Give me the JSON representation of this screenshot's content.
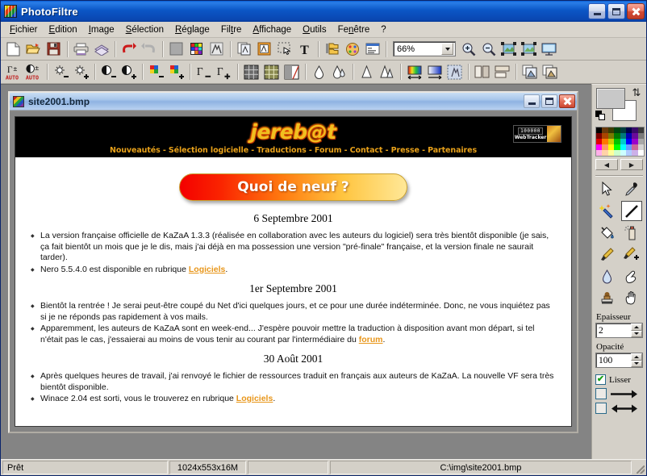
{
  "app": {
    "title": "PhotoFiltre",
    "icon": "photofiltre-logo-icon",
    "window_buttons": {
      "minimize": "–",
      "maximize": "□",
      "close": "✕"
    }
  },
  "menubar": {
    "items": [
      {
        "label": "Fichier",
        "name": "menu-fichier"
      },
      {
        "label": "Edition",
        "name": "menu-edition"
      },
      {
        "label": "Image",
        "name": "menu-image"
      },
      {
        "label": "Sélection",
        "name": "menu-selection"
      },
      {
        "label": "Réglage",
        "name": "menu-reglage"
      },
      {
        "label": "Filtre",
        "name": "menu-filtre"
      },
      {
        "label": "Affichage",
        "name": "menu-affichage"
      },
      {
        "label": "Outils",
        "name": "menu-outils"
      },
      {
        "label": "Fenêtre",
        "name": "menu-fenetre"
      },
      {
        "label": "?",
        "name": "menu-aide"
      }
    ]
  },
  "toolbar_main": {
    "zoom_value": "66%",
    "buttons": [
      "new-document-icon",
      "open-folder-icon",
      "save-floppy-icon",
      "print-icon",
      "print-preview-icon",
      "undo-arrow-icon",
      "redo-arrow-icon",
      "gray-square-icon",
      "color-palette-icon",
      "transparency-icon",
      "copy-image-icon",
      "paste-frame-icon",
      "selection-marquee-icon",
      "text-tool-icon",
      "folder-explorer-icon",
      "effects-palette-icon",
      "window-list-icon"
    ],
    "zoom_buttons": [
      "zoom-in-icon",
      "zoom-out-icon",
      "fit-width-icon",
      "fit-screen-icon",
      "full-screen-icon"
    ]
  },
  "toolbar_adjust": {
    "buttons": [
      "auto-gamma-icon",
      "auto-contrast-icon",
      "brightness-minus-icon",
      "brightness-plus-icon",
      "contrast-minus-icon",
      "contrast-plus-icon",
      "saturation-minus-icon",
      "saturation-plus-icon",
      "gamma-minus-icon",
      "gamma-plus-icon",
      "dither-grid-icon",
      "halftone-grid-icon",
      "bw-pattern-icon",
      "drop-soft-icon",
      "drop-blur-icon",
      "sharpen-icon",
      "sharpen-more-icon",
      "gradient-linear-icon",
      "gradient-blue-icon",
      "texture-icon",
      "flip-horizontal-icon",
      "flip-vertical-icon",
      "duplicate-layer-icon",
      "image-copy-icon"
    ]
  },
  "document": {
    "title": "site2001.bmp",
    "icon": "image-file-icon",
    "window_buttons": {
      "minimize": "–",
      "maximize": "□",
      "close": "✕"
    },
    "content": {
      "site_logo": "jereb@t",
      "nav": "Nouveautés - Sélection logicielle - Traductions - Forum - Contact - Presse - Partenaires",
      "tracker": {
        "count": "100000",
        "label": "WebTracker"
      },
      "banner": "Quoi de neuf ?",
      "sections": [
        {
          "date": "6 Septembre 2001",
          "items": [
            "La version française officielle de KaZaA 1.3.3 (réalisée en collaboration avec les auteurs du logiciel) sera très bientôt disponible (je sais, ça fait bientôt un mois que je le dis, mais j'ai déjà en ma possession une version \"pré-finale\" française, et la version finale ne saurait tarder).",
            "Nero 5.5.4.0 est disponible en rubrique Logiciels."
          ],
          "links": [
            "",
            "Logiciels"
          ]
        },
        {
          "date": "1er Septembre 2001",
          "items": [
            "Bientôt la rentrée ! Je serai peut-être coupé du Net d'ici quelques jours, et ce pour une durée indéterminée. Donc, ne vous inquiétez pas si je ne réponds pas rapidement à vos mails.",
            "Apparemment, les auteurs de KaZaA sont en week-end... J'espère pouvoir mettre la traduction à disposition avant mon départ, si tel n'était pas le cas, j'essaierai au moins de vous tenir au courant par l'intermédiaire du forum."
          ],
          "links": [
            "",
            "forum"
          ]
        },
        {
          "date": "30 Août 2001",
          "items": [
            "Après quelques heures de travail, j'ai renvoyé le fichier de ressources traduit en français aux auteurs de KaZaA. La nouvelle VF sera très bientôt disponible.",
            "Winace 2.04 est sorti, vous le trouverez en rubrique Logiciels."
          ],
          "links": [
            "",
            "Logiciels"
          ]
        }
      ]
    }
  },
  "palette": {
    "foreground_color": "#c8c8c8",
    "background_color": "#ffffff",
    "swap_icon": "swap-colors-icon",
    "reset_icon": "reset-colors-icon",
    "prev_label": "◀",
    "next_label": "▶",
    "colors": [
      "#000000",
      "#6b3a0a",
      "#3c3c00",
      "#00440e",
      "#003c3c",
      "#00004a",
      "#3a0a6b",
      "#3a3a3a",
      "#7a0000",
      "#aa4400",
      "#7a7a00",
      "#007a00",
      "#007a7a",
      "#0000b4",
      "#6a0a9a",
      "#7a7a7a",
      "#e00000",
      "#ff7700",
      "#cccc00",
      "#00c400",
      "#00cccc",
      "#0000ff",
      "#9a00cc",
      "#a8a8a8",
      "#ff00ff",
      "#ff9966",
      "#ffff00",
      "#00ff00",
      "#00ffff",
      "#6699ff",
      "#cc6699",
      "#d4d4d4",
      "#ffb0e8",
      "#ffd2a8",
      "#ffff99",
      "#ccffcc",
      "#ccffff",
      "#b0ccff",
      "#ccb0e8",
      "#ffffff"
    ],
    "tools": [
      {
        "name": "pointer-select-icon",
        "glyph": "arrow",
        "selected": false
      },
      {
        "name": "eyedropper-icon",
        "glyph": "dropper",
        "selected": false
      },
      {
        "name": "magic-wand-icon",
        "glyph": "wand",
        "selected": false
      },
      {
        "name": "line-tool-icon",
        "glyph": "line",
        "selected": true
      },
      {
        "name": "paint-bucket-icon",
        "glyph": "bucket",
        "selected": false
      },
      {
        "name": "spray-can-icon",
        "glyph": "spray",
        "selected": false
      },
      {
        "name": "paintbrush-icon",
        "glyph": "brush",
        "selected": false
      },
      {
        "name": "paintbrush-plus-icon",
        "glyph": "brush2",
        "selected": false
      },
      {
        "name": "waterdrop-blur-icon",
        "glyph": "drop",
        "selected": false
      },
      {
        "name": "smudge-finger-icon",
        "glyph": "smudge",
        "selected": false
      },
      {
        "name": "clone-stamp-icon",
        "glyph": "stamp",
        "selected": false
      },
      {
        "name": "hand-pan-icon",
        "glyph": "hand",
        "selected": false
      }
    ],
    "thickness_label": "Epaisseur",
    "thickness_value": "2",
    "opacity_label": "Opacité",
    "opacity_value": "100",
    "smooth_label": "Lisser",
    "smooth_checked": true,
    "arrow_single_label": "⟶",
    "arrow_double_label": "⟷"
  },
  "statusbar": {
    "state": "Prêt",
    "dimensions": "1024x553x16M",
    "path": "C:\\img\\site2001.bmp"
  }
}
